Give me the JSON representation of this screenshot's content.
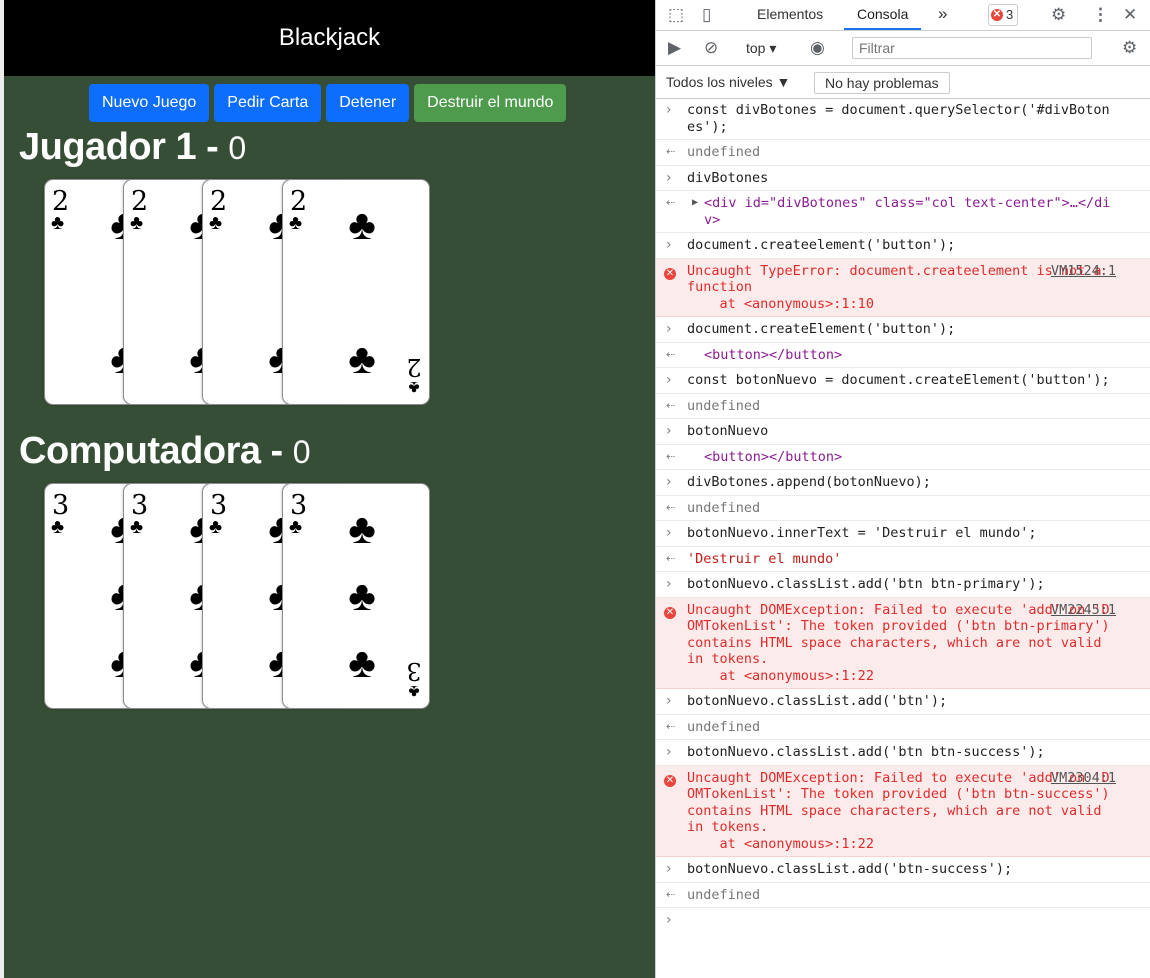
{
  "app": {
    "title": "Blackjack",
    "buttons": {
      "new_game": "Nuevo Juego",
      "hit": "Pedir Carta",
      "stop": "Detener",
      "destroy": "Destruir el mundo"
    },
    "player": {
      "name": "Jugador 1 -",
      "score": "0",
      "rank": "2",
      "suit": "♣",
      "cards": [
        "2C",
        "2C",
        "2C",
        "2C"
      ]
    },
    "computer": {
      "name": "Computadora -",
      "score": "0",
      "rank": "3",
      "suit": "♣",
      "cards": [
        "3C",
        "3C",
        "3C",
        "3C"
      ]
    }
  },
  "devtools": {
    "tabs": {
      "elements": "Elementos",
      "console": "Consola",
      "more": "»"
    },
    "error_count": "3",
    "context": "top",
    "filter_placeholder": "Filtrar",
    "levels": "Todos los niveles ▼",
    "issues": "No hay problemas",
    "entries": [
      "const divBotones = document.querySelector('#divBotones');",
      "undefined",
      "divBotones",
      "<div id=\"divBotones\" class=\"col text-center\">…</div>",
      "document.createelement('button');",
      "Uncaught TypeError: document.createelement is not a function\n    at <anonymous>:1:10",
      "VM1524:1",
      "document.createElement('button');",
      "<button></button>",
      "const botonNuevo = document.createElement('button');",
      "undefined",
      "botonNuevo",
      "<button></button>",
      "divBotones.append(botonNuevo);",
      "undefined",
      "botonNuevo.innerText = 'Destruir el mundo';",
      "'Destruir el mundo'",
      "botonNuevo.classList.add('btn btn-primary');",
      "Uncaught DOMException: Failed to execute 'add' on 'DOMTokenList': The token provided ('btn btn-primary') contains HTML space characters, which are not valid in tokens.\n    at <anonymous>:1:22",
      "VM2245:1",
      "botonNuevo.classList.add('btn');",
      "undefined",
      "botonNuevo.classList.add('btn btn-success');",
      "Uncaught DOMException: Failed to execute 'add' on 'DOMTokenList': The token provided ('btn btn-success') contains HTML space characters, which are not valid in tokens.\n    at <anonymous>:1:22",
      "VM2304:1",
      "botonNuevo.classList.add('btn-success');",
      "undefined"
    ]
  }
}
